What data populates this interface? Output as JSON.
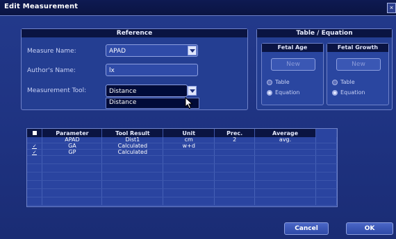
{
  "window": {
    "title": "Edit Measurement",
    "close_glyph": "×"
  },
  "reference": {
    "header": "Reference",
    "measure_name_label": "Measure Name:",
    "measure_name_value": "APAD",
    "author_label": "Author's Name:",
    "author_value": "lx",
    "tool_label": "Measurement Tool:",
    "tool_value": "Distance",
    "tool_options": [
      "Distance"
    ]
  },
  "table_equation": {
    "header": "Table / Equation",
    "fetal_age": {
      "title": "Fetal Age",
      "new_label": "New",
      "options": [
        "Table",
        "Equation"
      ],
      "selected": "Equation"
    },
    "fetal_growth": {
      "title": "Fetal Growth",
      "new_label": "New",
      "options": [
        "Table",
        "Equation"
      ],
      "selected": "Equation"
    }
  },
  "params_table": {
    "columns": [
      "",
      "Parameter",
      "Tool Result",
      "Unit",
      "Prec.",
      "Average"
    ],
    "rows": [
      {
        "checked": false,
        "parameter": "APAD",
        "tool_result": "Dist1",
        "unit": "cm",
        "prec": "2",
        "average": "avg."
      },
      {
        "checked": true,
        "parameter": "GA",
        "tool_result": "Calculated",
        "unit": "w+d",
        "prec": "",
        "average": ""
      },
      {
        "checked": true,
        "parameter": "GP",
        "tool_result": "Calculated",
        "unit": "",
        "prec": "",
        "average": ""
      }
    ]
  },
  "buttons": {
    "cancel": "Cancel",
    "ok": "OK"
  }
}
